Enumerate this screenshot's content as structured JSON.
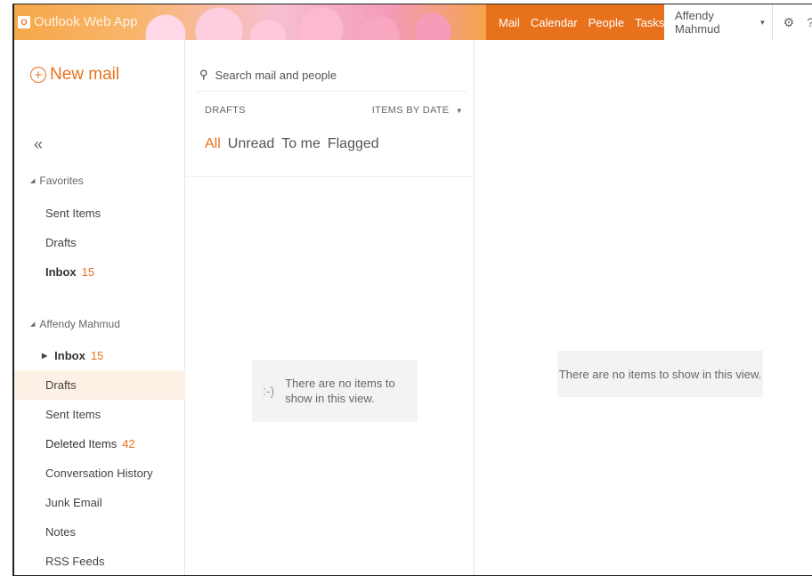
{
  "topbar": {
    "app_title": "Outlook Web App",
    "logo_text": "O",
    "nav": [
      "Mail",
      "Calendar",
      "People",
      "Tasks"
    ],
    "user_name": "Affendy Mahmud",
    "caret": "▾",
    "gear": "⚙",
    "help": "?",
    "accent": "#e8711c"
  },
  "leftnav": {
    "new_mail_label": "New mail",
    "collapse_glyph": "«",
    "favorites": {
      "header": "Favorites",
      "items": [
        {
          "label": "Sent Items",
          "count": ""
        },
        {
          "label": "Drafts",
          "count": ""
        },
        {
          "label": "Inbox",
          "count": "15"
        }
      ]
    },
    "mailbox": {
      "header": "Affendy Mahmud",
      "items": [
        {
          "label": "Inbox",
          "count": "15"
        },
        {
          "label": "Drafts",
          "count": ""
        },
        {
          "label": "Sent Items",
          "count": ""
        },
        {
          "label": "Deleted Items",
          "count": "42"
        },
        {
          "label": "Conversation History",
          "count": ""
        },
        {
          "label": "Junk Email",
          "count": ""
        },
        {
          "label": "Notes",
          "count": ""
        },
        {
          "label": "RSS Feeds",
          "count": ""
        }
      ]
    }
  },
  "middle": {
    "search_placeholder": "Search mail and people",
    "folder_name": "DRAFTS",
    "sort_label": "ITEMS BY DATE",
    "sort_caret": "▼",
    "filters": [
      "All",
      "Unread",
      "To me",
      "Flagged"
    ],
    "empty_face": ":-)",
    "empty_text_1": "There are no items to",
    "empty_text_2": "show in this view."
  },
  "reading": {
    "empty_text": "There are no items to show in this view."
  }
}
